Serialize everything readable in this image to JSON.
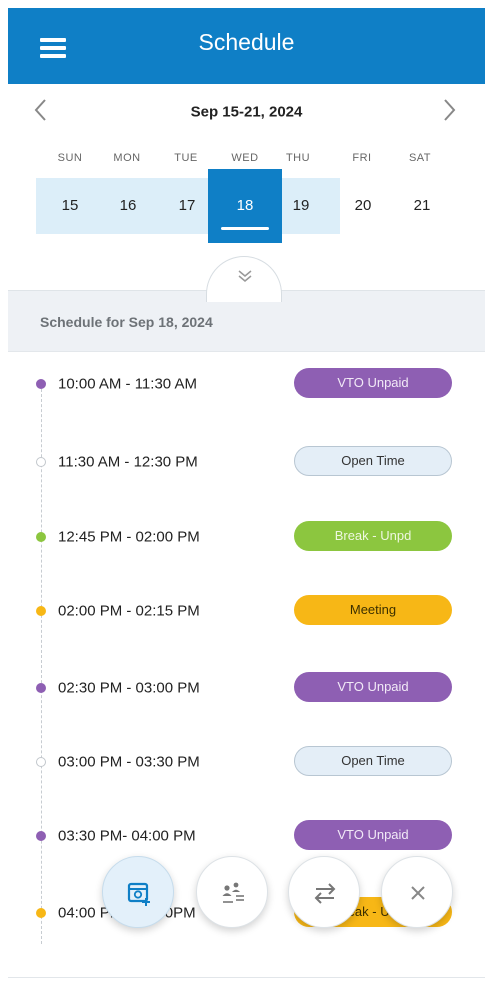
{
  "header": {
    "title": "Schedule",
    "menu_icon": "hamburger-menu-icon"
  },
  "week": {
    "range_label": "Sep 15-21, 2024",
    "prev_icon": "chevron-left-icon",
    "next_icon": "chevron-right-icon",
    "days": [
      {
        "name": "SUN",
        "date": "15"
      },
      {
        "name": "MON",
        "date": "16"
      },
      {
        "name": "TUE",
        "date": "17"
      },
      {
        "name": "WED",
        "date": "18"
      },
      {
        "name": "THU",
        "date": "19"
      },
      {
        "name": "FRI",
        "date": "20"
      },
      {
        "name": "SAT",
        "date": "21"
      }
    ],
    "selected_index": 3,
    "expand_icon": "double-chevron-down-icon"
  },
  "schedule": {
    "heading": "Schedule for Sep 18, 2024",
    "items": [
      {
        "time": "10:00 AM - 11:30 AM",
        "label": "VTO Unpaid",
        "kind": "vto",
        "color": "#8e5fb3"
      },
      {
        "time": "11:30 AM - 12:30 PM",
        "label": "Open Time",
        "kind": "open",
        "color": "#d0d4d8"
      },
      {
        "time": "12:45 PM - 02:00 PM",
        "label": "Break - Unpd",
        "kind": "break",
        "color": "#8cc63f"
      },
      {
        "time": "02:00 PM - 02:15 PM",
        "label": "Meeting",
        "kind": "meeting",
        "color": "#f7b716"
      },
      {
        "time": "02:30 PM - 03:00 PM",
        "label": "VTO Unpaid",
        "kind": "vto",
        "color": "#8e5fb3"
      },
      {
        "time": "03:00 PM - 03:30 PM",
        "label": "Open Time",
        "kind": "open",
        "color": "#d0d4d8"
      },
      {
        "time": "03:30 PM- 04:00 PM",
        "label": "VTO Unpaid",
        "kind": "vto",
        "color": "#8e5fb3"
      },
      {
        "time": "04:00 PM - 04:30PM",
        "label": "Break - Unpd",
        "kind": "break-partial",
        "color": "#f7b716"
      }
    ]
  },
  "actions": [
    {
      "name": "add-time-off-fab",
      "icon": "calendar-add-icon"
    },
    {
      "name": "team-fab",
      "icon": "people-list-icon"
    },
    {
      "name": "swap-shift-fab",
      "icon": "swap-arrows-icon"
    },
    {
      "name": "close-fab",
      "icon": "close-icon"
    }
  ],
  "colors": {
    "brand": "#0f7fc6",
    "selected_week_bg": "#dceef9",
    "vto": "#8e5fb3",
    "break": "#8cc63f",
    "meeting": "#f7b716",
    "open": "#e4eef7"
  }
}
